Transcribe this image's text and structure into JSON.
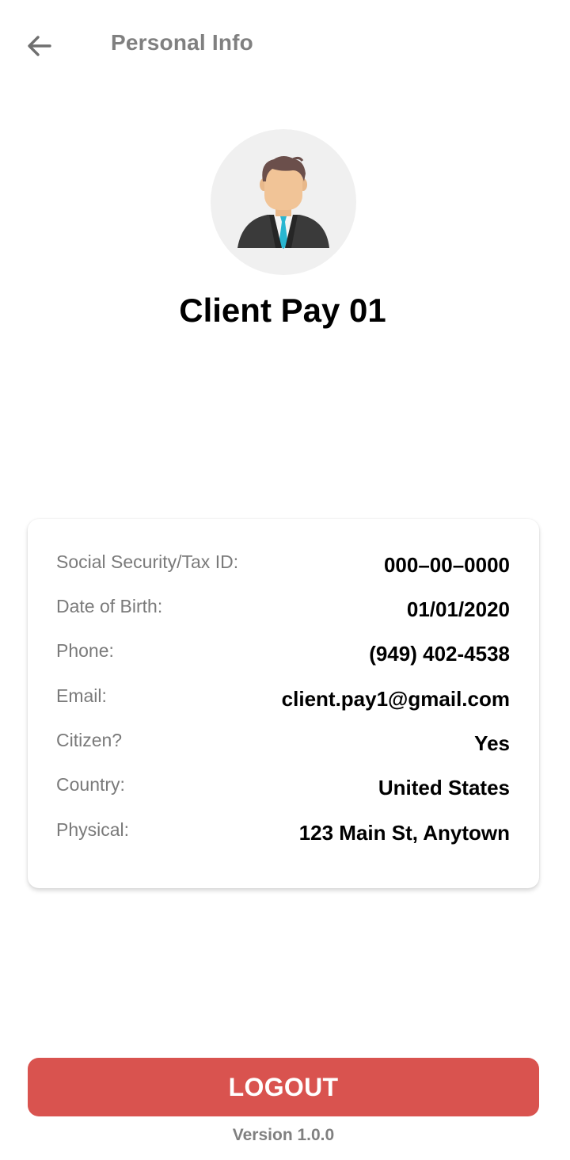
{
  "header": {
    "back_icon": "arrow-left-icon",
    "title": "Personal Info"
  },
  "profile": {
    "avatar_icon": "businessman-avatar-icon",
    "name": "Client Pay 01"
  },
  "info": {
    "rows": [
      {
        "label": "Social Security/Tax ID:",
        "value": "000–00–0000"
      },
      {
        "label": "Date of Birth:",
        "value": "01/01/2020"
      },
      {
        "label": "Phone:",
        "value": "(949) 402-4538"
      },
      {
        "label": "Email:",
        "value": "client.pay1@gmail.com"
      },
      {
        "label": "Citizen?",
        "value": "Yes"
      },
      {
        "label": "Country:",
        "value": "United States"
      },
      {
        "label": "Physical:",
        "value": "123 Main St, Anytown"
      }
    ]
  },
  "footer": {
    "logout_label": "LOGOUT",
    "version": "Version 1.0.0"
  },
  "colors": {
    "logout_background": "#d9534f",
    "title_gray": "#808080",
    "label_gray": "#7a7a7a",
    "avatar_background": "#f0f0f0",
    "tie": "#29b6d1"
  }
}
